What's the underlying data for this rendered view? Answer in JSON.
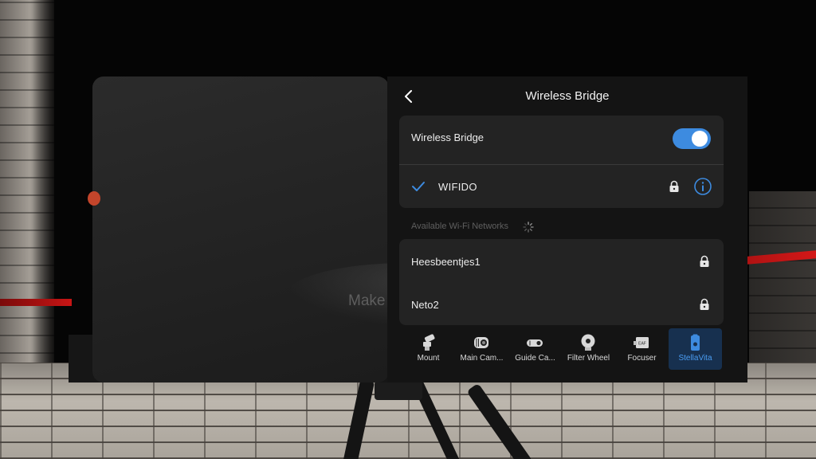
{
  "header": {
    "title": "Wireless Bridge"
  },
  "left_panel": {
    "hint_text": "Make"
  },
  "bridge_card": {
    "label": "Wireless Bridge",
    "enabled": true,
    "connected_network": "WIFIDO"
  },
  "available_section": {
    "label": "Available Wi-Fi Networks"
  },
  "networks": [
    {
      "name": "Heesbeentjes1",
      "secured": true
    },
    {
      "name": "Neto2",
      "secured": true
    }
  ],
  "tabs": [
    {
      "label": "Mount",
      "icon": "mount-icon",
      "active": false
    },
    {
      "label": "Main Cam...",
      "icon": "main-camera-icon",
      "active": false
    },
    {
      "label": "Guide Ca...",
      "icon": "guide-camera-icon",
      "active": false
    },
    {
      "label": "Filter Wheel",
      "icon": "filter-wheel-icon",
      "active": false
    },
    {
      "label": "Focuser",
      "icon": "focuser-icon",
      "active": false
    },
    {
      "label": "StellaVita",
      "icon": "stellavita-icon",
      "active": true
    }
  ],
  "colors": {
    "accent": "#3d8be0",
    "active_tab_bg": "#17304f",
    "active_tab_text": "#4a9cf2"
  }
}
